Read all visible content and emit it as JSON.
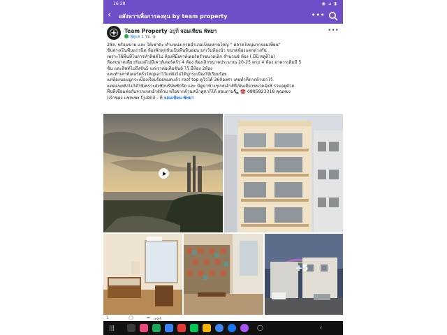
{
  "status_bar": {
    "time": "16:38",
    "icons": "◉ ⊿ ▮"
  },
  "app_bar": {
    "back_icon": "back-arrow-icon",
    "title": "อสังหาฯเพื่อการลงทุน  by team property",
    "more_label": "•••",
    "search_icon": "search-icon"
  },
  "post": {
    "author": "Team Property",
    "location_prefix": "อยู่ที่",
    "location": "จอมเทียน พัทยา",
    "badge": "ผู้ดูแล",
    "time": "1 ชม.",
    "more_label": "•••",
    "lines": [
      "28ล. พร้อมขาย และ ให้เช่าค่ะ ตำแหน่งเกรดอำเภอเป็นตลาดใหญ่ \" ตลาดใหญ่มากจอมเทียน\"",
      "ชั้นล่างเป็นพื้นแกรนิต ห้องพักทุกชั้นเป็นพื้นหินอ่อน ยกเว้นห้องน้ำ ขนาดห้องแตกต่างกัน",
      "เพราะใช้พื้นที่ในการทำลิฟต์ไป  ห้องที่มีเคาท์เตอร์ครัวขนาดเล็ก จำนวน8 ห้อง ( มีนิ สตูดิโอ)",
      "ห้องขนาดเดียวกันแต่ไม่มีเคาท์เตอร์ครัว 4 ห้อง ห้องเล็กขนาดประมาณ 20-25 ตรม 4 ห้อง  อาคารเดิมมี 5",
      "ชั้น และลิฟต์ไปถึงชั้น5 แต่เราต่อเติมชั้น6 ไว้ มีห้อง 2ห้อง",
      "และทำเคาท์เตอร์ครัวใหญ่เอาไว้แต่ยังไม่ได้ปูกระเบื้องให้เรียบร้อย",
      "แต่ห้องนอนปูกระเบื้องเรียบร้อยหมดแล้ว  roof top ดูวิวได้ 360องศา  เคยทำที่ตากผ้าเอาไว้",
      "แต่ตอนหลังไม่ได้ใช้เพราะส่งซักบริษัทซักรีด และ มีคูหาข้างๆเกสเฮ้าส์ที่เป็นเดียวขนาด4x8 รวมอยู่ด้วย",
      "พื้นที่เชื่อมต่อกันจากเกสเฮ้าส์ด้วย หรือจากด้านหน้าคูหาก็ได้ สอบถาม📞 ☎️ 0885823318 คุณหยง",
      "(เจ้าของ แชทเพจ f.jubili) - ที่"
    ],
    "location_link": "จอมเทียน พัทยา"
  },
  "photos": [
    {
      "name": "beach-video",
      "type": "video",
      "play_icon": "play-icon"
    },
    {
      "name": "building-facade",
      "type": "photo"
    },
    {
      "name": "bedroom",
      "type": "photo"
    },
    {
      "name": "tiled-kitchen",
      "type": "photo"
    },
    {
      "name": "street-view",
      "type": "photo",
      "overlay_label": "+5"
    }
  ],
  "actions": {
    "like_count": "1",
    "comment_icon": "comment-icon",
    "share_icon": "share-icon",
    "share_count": "แชร์"
  },
  "nav": {
    "apps": [
      "grid-icon",
      "gallery-icon",
      "chat-icon",
      "mail-icon",
      "youtube-icon",
      "line-icon",
      "calendar-icon",
      "chrome-icon",
      "facebook-icon",
      "messenger-icon"
    ],
    "colors": [
      "#3a3a3a",
      "#e84a7a",
      "#1aa85a",
      "#3b82f6",
      "#e53935",
      "#06c755",
      "#f4b400",
      "#4285f4",
      "#1877f2",
      "#a855f7"
    ]
  },
  "colors": {
    "accent": "#6f4ec9",
    "link": "#1877f2"
  }
}
